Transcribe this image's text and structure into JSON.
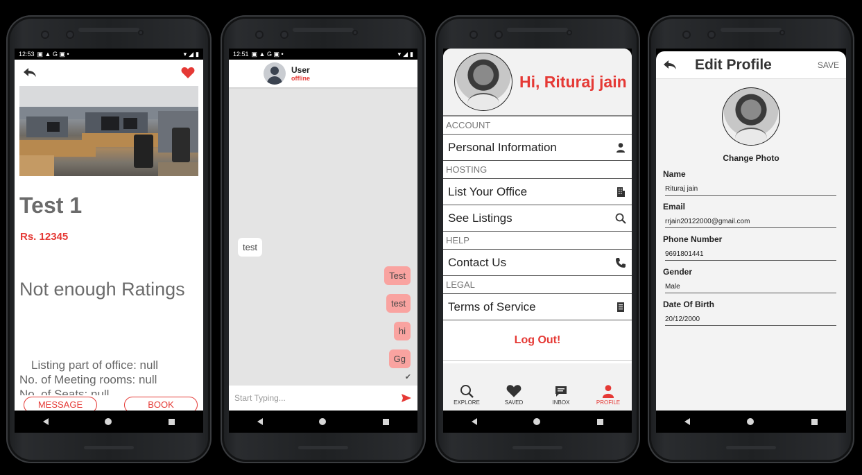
{
  "screen1": {
    "status_time": "12:53",
    "title": "Test 1",
    "price": "Rs. 12345",
    "ratings": "Not enough Ratings",
    "info_lines": [
      "Listing part of office: null",
      "No. of Meeting rooms: null",
      "No. of Seats: null"
    ],
    "message_label": "MESSAGE",
    "book_label": "BOOK",
    "accent": "#e53935"
  },
  "screen2": {
    "status_time": "12:51",
    "user_name": "User",
    "user_status": "offline",
    "messages": [
      {
        "text": "test",
        "dir": "in"
      },
      {
        "text": "Test",
        "dir": "out"
      },
      {
        "text": "test",
        "dir": "out"
      },
      {
        "text": "hi",
        "dir": "out"
      },
      {
        "text": "Gg",
        "dir": "out"
      }
    ],
    "input_placeholder": "Start Typing...",
    "bubble_color": "#f9a3a0"
  },
  "screen3": {
    "greeting": "Hi, Rituraj jain",
    "sections": {
      "account": "ACCOUNT",
      "hosting": "HOSTING",
      "help": "HELP",
      "legal": "LEGAL"
    },
    "rows": {
      "personal_info": "Personal Information",
      "list_office": "List Your Office",
      "see_listings": "See Listings",
      "contact_us": "Contact Us",
      "terms": "Terms of Service"
    },
    "logout": "Log Out!",
    "tabs": {
      "explore": "EXPLORE",
      "saved": "SAVED",
      "inbox": "INBOX",
      "profile": "PROFILE"
    }
  },
  "screen4": {
    "title": "Edit Profile",
    "save": "SAVE",
    "change_photo": "Change Photo",
    "fields": {
      "name_label": "Name",
      "name_value": "Rituraj jain",
      "email_label": "Email",
      "email_value": "rrjain20122000@gmail.com",
      "phone_label": "Phone Number",
      "phone_value": "9691801441",
      "gender_label": "Gender",
      "gender_value": "Male",
      "dob_label": "Date Of Birth",
      "dob_value": "20/12/2000"
    }
  }
}
